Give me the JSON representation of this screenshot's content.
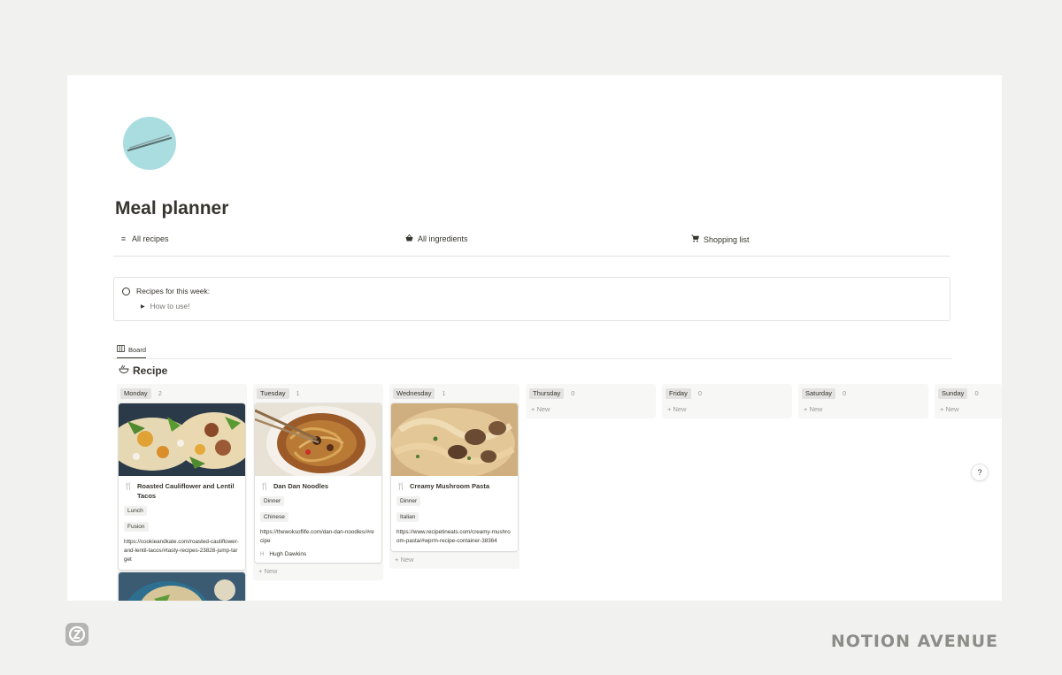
{
  "page": {
    "title": "Meal planner",
    "icon": "chopsticks-icon"
  },
  "links": [
    {
      "label": "All recipes",
      "icon": "list-icon"
    },
    {
      "label": "All ingredients",
      "icon": "basket-icon"
    },
    {
      "label": "Shopping list",
      "icon": "cart-icon"
    }
  ],
  "callout": {
    "title": "Recipes for this week:",
    "toggle": "How to use!"
  },
  "view": {
    "tab_label": "Board"
  },
  "database": {
    "title": "Recipe"
  },
  "columns": [
    {
      "label": "Monday",
      "count": "2"
    },
    {
      "label": "Tuesday",
      "count": "1"
    },
    {
      "label": "Wednesday",
      "count": "1"
    },
    {
      "label": "Thursday",
      "count": "0"
    },
    {
      "label": "Friday",
      "count": "0"
    },
    {
      "label": "Saturday",
      "count": "0"
    },
    {
      "label": "Sunday",
      "count": "0"
    }
  ],
  "cards": {
    "monday": {
      "title": "Roasted Cauliflower and Lentil Tacos",
      "meal": "Lunch",
      "cuisine": "Fusion",
      "url": "https://cookieandkate.com/roasted-cauliflower-and-lentil-tacos/#tasty-recipes-23828-jump-target"
    },
    "tuesday": {
      "title": "Dan Dan Noodles",
      "meal": "Dinner",
      "cuisine": "Chinese",
      "url": "https://thewoksoflife.com/dan-dan-noodles/#recipe",
      "person_initial": "H",
      "person": "Hugh Dawkins"
    },
    "wednesday": {
      "title": "Creamy Mushroom Pasta",
      "meal": "Dinner",
      "cuisine": "Italian",
      "url": "https://www.recipetineats.com/creamy-mushroom-pasta/#wprm-recipe-container-38364"
    }
  },
  "new_label": "New",
  "help_label": "?",
  "brand": "NOTION AVENUE"
}
